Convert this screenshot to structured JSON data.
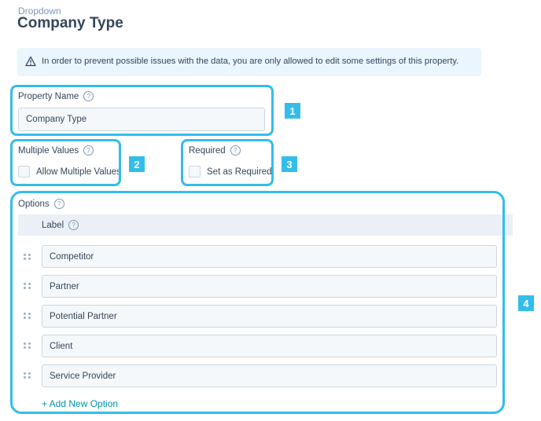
{
  "header": {
    "eyebrow": "Dropdown",
    "title": "Company Type"
  },
  "alert": {
    "icon": "warning-icon",
    "text": "In order to prevent possible issues with the data, you are only allowed to edit some settings of this property."
  },
  "property_name": {
    "label": "Property Name",
    "value": "Company Type"
  },
  "multiple_values": {
    "label": "Multiple Values",
    "checkbox_label": "Allow Multiple Values",
    "checked": false
  },
  "required": {
    "label": "Required",
    "checkbox_label": "Set as Required",
    "checked": false
  },
  "options": {
    "label": "Options",
    "column_header": "Label",
    "items": [
      "Competitor",
      "Partner",
      "Potential Partner",
      "Client",
      "Service Provider"
    ],
    "add_label": "+ Add New Option"
  },
  "callouts": [
    "1",
    "2",
    "3",
    "4"
  ],
  "colors": {
    "highlight": "#33bdec",
    "link": "#0091ae",
    "text": "#33475b",
    "alert_bg": "#eaf5fe"
  }
}
